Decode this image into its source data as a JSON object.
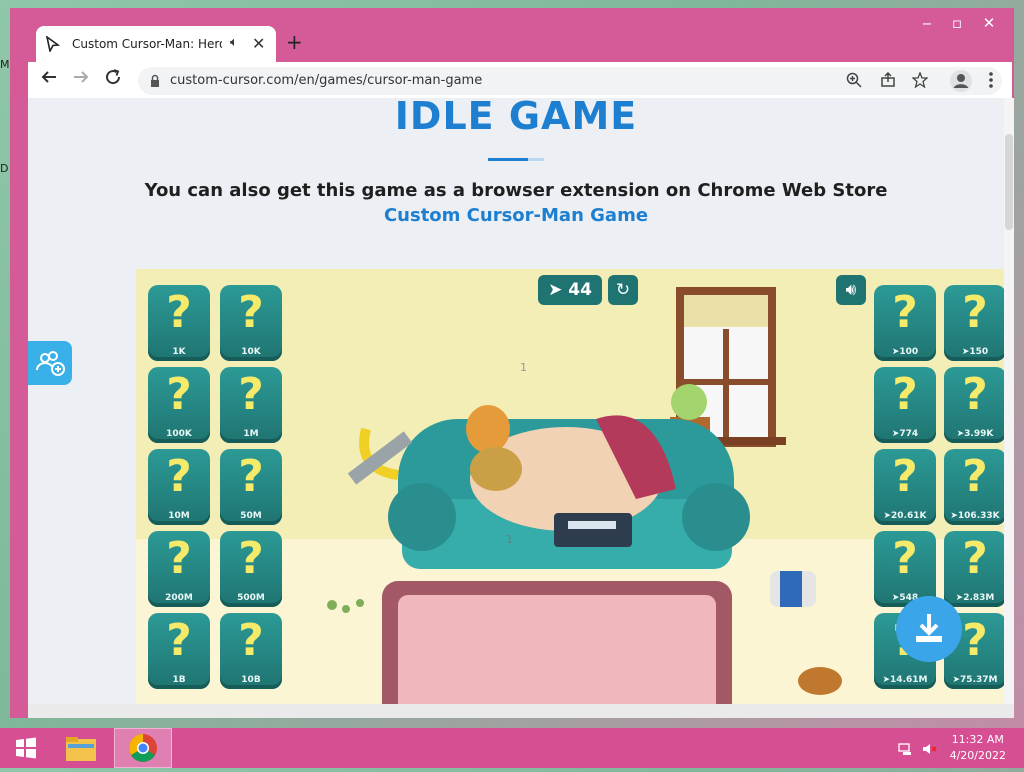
{
  "desktop": {
    "edge_letters": [
      "M",
      "D"
    ]
  },
  "window": {
    "minimize": "‒",
    "maximize": "▫",
    "close": "✕"
  },
  "tab": {
    "title": "Custom Cursor-Man: Hero's I",
    "close": "✕",
    "new_tab": "+"
  },
  "toolbar": {
    "url": "custom-cursor.com/en/games/cursor-man-game"
  },
  "page": {
    "heading": "IDLE GAME",
    "subtitle_text": "You can also get this game as a browser extension on Chrome Web Store",
    "subtitle_link": "Custom Cursor-Man Game"
  },
  "game": {
    "cursor_count": "44",
    "left_cards": [
      "1K",
      "10K",
      "100K",
      "1M",
      "10M",
      "50M",
      "200M",
      "500M",
      "1B",
      "10B"
    ],
    "right_cards": [
      "100",
      "150",
      "774",
      "3.99K",
      "20.61K",
      "106.33K",
      "548",
      "2.83M",
      "14.61M",
      "75.37M"
    ],
    "floating_number_1": "1",
    "floating_number_2": "1"
  },
  "taskbar": {
    "time": "11:32 AM",
    "date": "4/20/2022"
  }
}
